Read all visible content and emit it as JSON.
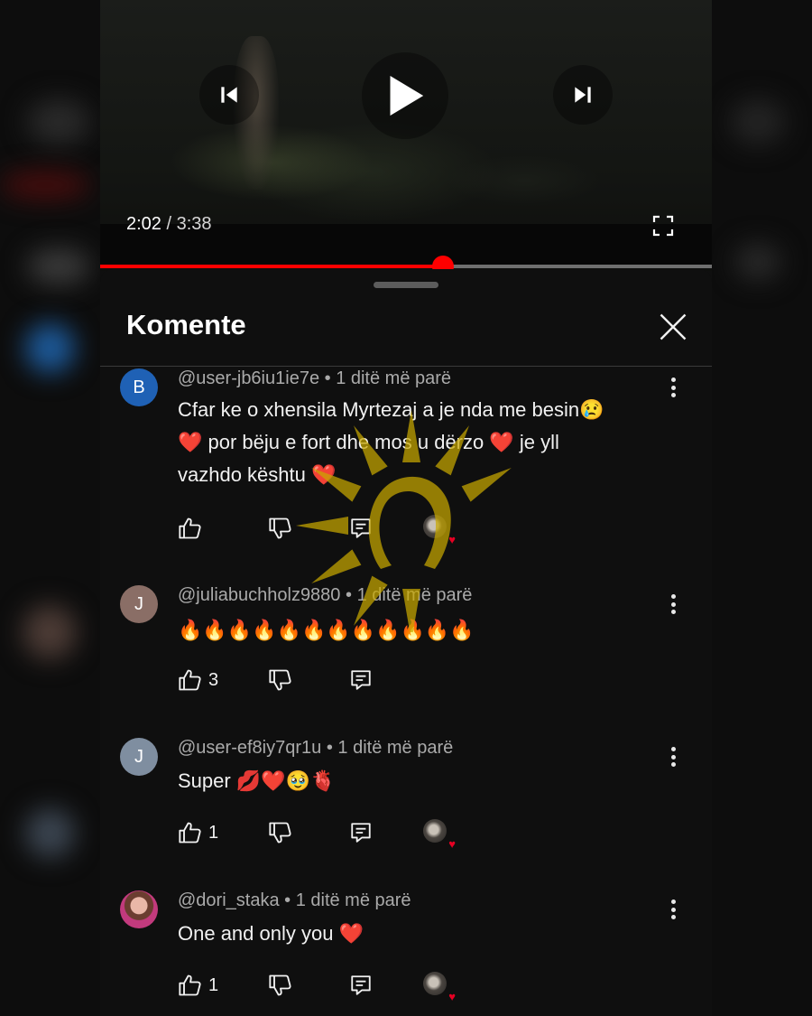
{
  "player": {
    "current_time": "2:02",
    "separator": "/",
    "duration": "3:38",
    "progress_fraction": 0.561,
    "accent_color": "#ff0000",
    "icons": [
      "previous-icon",
      "play-icon",
      "next-icon",
      "fullscreen-icon"
    ]
  },
  "comments_panel": {
    "title": "Komente",
    "close_icon": "close-icon"
  },
  "comments": [
    {
      "avatar_letter": "B",
      "avatar_color": "#1f61b5",
      "author": "@user-jb6iu1ie7e",
      "time": "1 ditë më parë",
      "lines": [
        "Cfar ke o xhensila Myrtezaj a je nda me besin😢",
        "❤️ por bëju e fort dhe mos u  dërzo ❤️ je yll",
        "vazhdo kështu ❤️"
      ],
      "likes": "",
      "creator_heart": true
    },
    {
      "avatar_letter": "J",
      "avatar_color": "#8a6e66",
      "author": "@juliabuchholz9880",
      "time": "1 ditë më parë",
      "lines": [
        "🔥🔥🔥🔥🔥🔥🔥🔥🔥🔥🔥🔥"
      ],
      "likes": "3",
      "creator_heart": false
    },
    {
      "avatar_letter": "J",
      "avatar_color": "#7f8ea0",
      "author": "@user-ef8iy7qr1u",
      "time": "1 ditë më parë",
      "lines": [
        "Super 💋❤️🥹🫀"
      ],
      "likes": "1",
      "creator_heart": true
    },
    {
      "avatar_letter": "",
      "avatar_color": "#c23a7d",
      "author": "@dori_staka",
      "time": "1 ditë më parë",
      "lines": [
        "One and only you ❤️"
      ],
      "likes": "1",
      "creator_heart": true
    }
  ],
  "action_icons": [
    "thumbs-up-icon",
    "thumbs-down-icon",
    "reply-icon",
    "creator-heart-icon",
    "more-vert-icon"
  ],
  "watermark": {
    "icon": "sun-logo-icon",
    "color": "#c8a800"
  }
}
